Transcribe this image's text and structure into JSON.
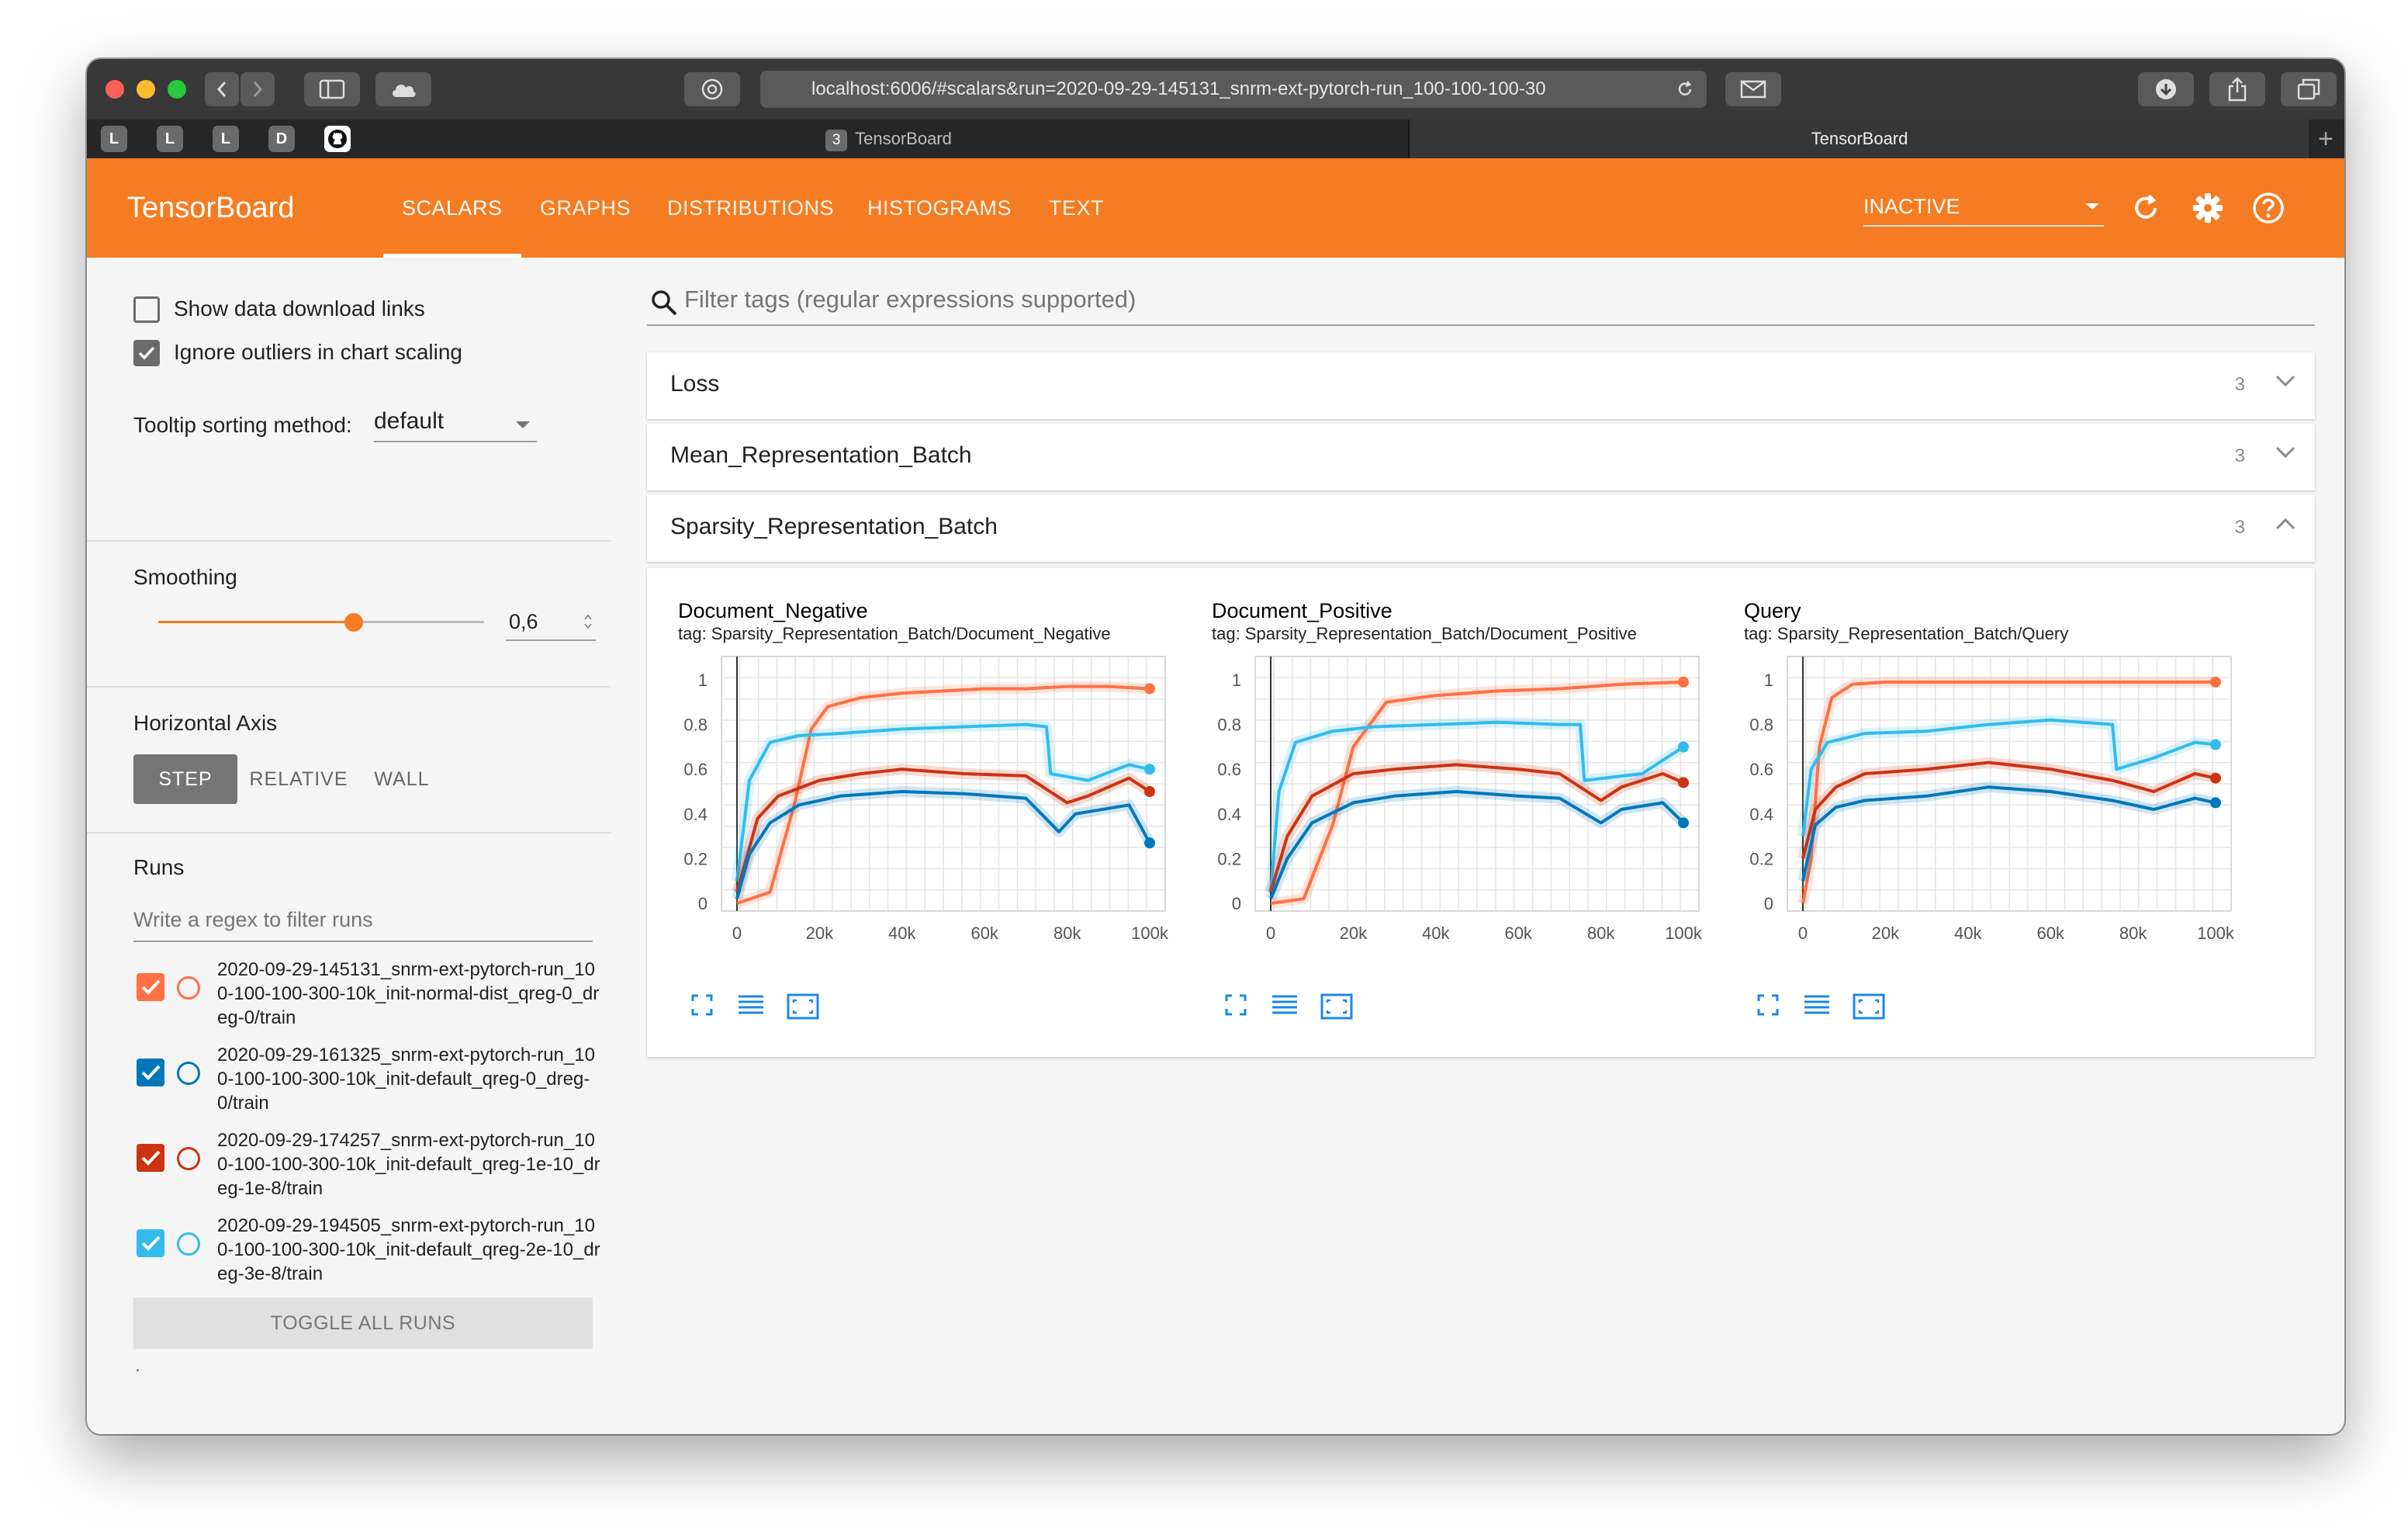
{
  "browser": {
    "url": "localhost:6006/#scalars&run=2020-09-29-145131_snrm-ext-pytorch-run_100-100-100-30",
    "bookmarks": [
      "L",
      "L",
      "L",
      "D"
    ],
    "tabs": [
      {
        "badge": "3",
        "label": "TensorBoard"
      },
      {
        "label": "TensorBoard"
      }
    ]
  },
  "header": {
    "brand": "TensorBoard",
    "nav": [
      "SCALARS",
      "GRAPHS",
      "DISTRIBUTIONS",
      "HISTOGRAMS",
      "TEXT"
    ],
    "active_nav": "SCALARS",
    "run_selector": "INACTIVE",
    "icons": [
      "refresh-icon",
      "settings-gear-icon",
      "help-icon"
    ]
  },
  "sidebar": {
    "show_download": {
      "label": "Show data download links",
      "checked": false
    },
    "ignore_outliers": {
      "label": "Ignore outliers in chart scaling",
      "checked": true
    },
    "tooltip_sort": {
      "label": "Tooltip sorting method:",
      "value": "default"
    },
    "smoothing": {
      "label": "Smoothing",
      "value": "0,6",
      "fraction": 0.6
    },
    "horizontal_axis": {
      "label": "Horizontal Axis",
      "options": [
        "STEP",
        "RELATIVE",
        "WALL"
      ],
      "selected": "STEP"
    },
    "runs": {
      "label": "Runs",
      "filter_placeholder": "Write a regex to filter runs",
      "items": [
        {
          "name": "2020-09-29-145131_snrm-ext-pytorch-run_100-100-100-300-10k_init-normal-dist_qreg-0_dreg-0/train",
          "color": "#ff7043",
          "checked": true
        },
        {
          "name": "2020-09-29-161325_snrm-ext-pytorch-run_100-100-100-300-10k_init-default_qreg-0_dreg-0/train",
          "color": "#0077bb",
          "checked": true
        },
        {
          "name": "2020-09-29-174257_snrm-ext-pytorch-run_100-100-100-300-10k_init-default_qreg-1e-10_dreg-1e-8/train",
          "color": "#cc3311",
          "checked": true
        },
        {
          "name": "2020-09-29-194505_snrm-ext-pytorch-run_100-100-100-300-10k_init-default_qreg-2e-10_dreg-3e-8/train",
          "color": "#33bbee",
          "checked": true
        }
      ],
      "toggle_label": "TOGGLE ALL RUNS",
      "footer": "."
    }
  },
  "main": {
    "filter_placeholder": "Filter tags (regular expressions supported)",
    "categories": [
      {
        "title": "Loss",
        "count": "3",
        "expanded": false
      },
      {
        "title": "Mean_Representation_Batch",
        "count": "3",
        "expanded": false
      },
      {
        "title": "Sparsity_Representation_Batch",
        "count": "3",
        "expanded": true
      }
    ]
  },
  "chart_data": [
    {
      "type": "line",
      "title": "Document_Negative",
      "tag": "tag: Sparsity_Representation_Batch/Document_Negative",
      "x_ticks": [
        "0",
        "20k",
        "40k",
        "60k",
        "80k",
        "100k"
      ],
      "y_ticks": [
        "0",
        "0.2",
        "0.4",
        "0.6",
        "0.8",
        "1"
      ],
      "xlim": [
        0,
        100000
      ],
      "ylim": [
        0,
        1
      ],
      "series": [
        {
          "color": "#ff7043",
          "x": [
            0,
            8000,
            14000,
            18000,
            22000,
            30000,
            40000,
            50000,
            60000,
            70000,
            80000,
            90000,
            100000
          ],
          "y": [
            0.0,
            0.05,
            0.45,
            0.78,
            0.88,
            0.92,
            0.94,
            0.95,
            0.96,
            0.96,
            0.97,
            0.97,
            0.96
          ]
        },
        {
          "color": "#33bbee",
          "x": [
            0,
            3000,
            8000,
            15000,
            25000,
            40000,
            55000,
            70000,
            75000,
            76000,
            85000,
            95000,
            100000
          ],
          "y": [
            0.1,
            0.55,
            0.72,
            0.75,
            0.76,
            0.78,
            0.79,
            0.8,
            0.79,
            0.58,
            0.55,
            0.62,
            0.6
          ]
        },
        {
          "color": "#cc3311",
          "x": [
            0,
            5000,
            10000,
            20000,
            30000,
            40000,
            55000,
            70000,
            80000,
            85000,
            95000,
            100000
          ],
          "y": [
            0.05,
            0.38,
            0.48,
            0.55,
            0.58,
            0.6,
            0.58,
            0.57,
            0.45,
            0.48,
            0.56,
            0.5
          ]
        },
        {
          "color": "#0077bb",
          "x": [
            0,
            3000,
            8000,
            15000,
            25000,
            40000,
            55000,
            70000,
            78000,
            82000,
            95000,
            100000
          ],
          "y": [
            0.02,
            0.22,
            0.36,
            0.44,
            0.48,
            0.5,
            0.49,
            0.47,
            0.32,
            0.4,
            0.44,
            0.27
          ]
        }
      ]
    },
    {
      "type": "line",
      "title": "Document_Positive",
      "tag": "tag: Sparsity_Representation_Batch/Document_Positive",
      "x_ticks": [
        "0",
        "20k",
        "40k",
        "60k",
        "80k",
        "100k"
      ],
      "y_ticks": [
        "0",
        "0.2",
        "0.4",
        "0.6",
        "0.8",
        "1"
      ],
      "xlim": [
        0,
        100000
      ],
      "ylim": [
        0,
        1
      ],
      "series": [
        {
          "color": "#ff7043",
          "x": [
            0,
            8000,
            15000,
            20000,
            28000,
            40000,
            55000,
            70000,
            85000,
            100000
          ],
          "y": [
            0.0,
            0.02,
            0.35,
            0.7,
            0.9,
            0.93,
            0.95,
            0.96,
            0.98,
            0.99
          ]
        },
        {
          "color": "#33bbee",
          "x": [
            0,
            2000,
            6000,
            15000,
            25000,
            40000,
            55000,
            70000,
            75000,
            76000,
            90000,
            100000
          ],
          "y": [
            0.05,
            0.5,
            0.72,
            0.77,
            0.79,
            0.8,
            0.81,
            0.8,
            0.8,
            0.55,
            0.58,
            0.7
          ]
        },
        {
          "color": "#cc3311",
          "x": [
            0,
            4000,
            10000,
            20000,
            30000,
            45000,
            60000,
            70000,
            80000,
            85000,
            95000,
            100000
          ],
          "y": [
            0.05,
            0.3,
            0.48,
            0.58,
            0.6,
            0.62,
            0.6,
            0.58,
            0.46,
            0.52,
            0.58,
            0.54
          ]
        },
        {
          "color": "#0077bb",
          "x": [
            0,
            4000,
            10000,
            20000,
            30000,
            45000,
            60000,
            70000,
            80000,
            85000,
            95000,
            100000
          ],
          "y": [
            0.02,
            0.2,
            0.36,
            0.45,
            0.48,
            0.5,
            0.48,
            0.47,
            0.36,
            0.42,
            0.45,
            0.36
          ]
        }
      ]
    },
    {
      "type": "line",
      "title": "Query",
      "tag": "tag: Sparsity_Representation_Batch/Query",
      "x_ticks": [
        "0",
        "20k",
        "40k",
        "60k",
        "80k",
        "100k"
      ],
      "y_ticks": [
        "0",
        "0.2",
        "0.4",
        "0.6",
        "0.8",
        "1"
      ],
      "xlim": [
        0,
        100000
      ],
      "ylim": [
        0,
        1
      ],
      "series": [
        {
          "color": "#ff7043",
          "x": [
            0,
            2000,
            4000,
            7000,
            12000,
            20000,
            40000,
            60000,
            80000,
            100000
          ],
          "y": [
            0.0,
            0.2,
            0.7,
            0.92,
            0.98,
            0.99,
            0.99,
            0.99,
            0.99,
            0.99
          ]
        },
        {
          "color": "#33bbee",
          "x": [
            0,
            2000,
            6000,
            15000,
            30000,
            45000,
            60000,
            75000,
            76000,
            85000,
            95000,
            100000
          ],
          "y": [
            0.3,
            0.6,
            0.72,
            0.76,
            0.77,
            0.8,
            0.82,
            0.8,
            0.6,
            0.65,
            0.72,
            0.71
          ]
        },
        {
          "color": "#cc3311",
          "x": [
            0,
            3000,
            8000,
            15000,
            30000,
            45000,
            60000,
            75000,
            85000,
            95000,
            100000
          ],
          "y": [
            0.2,
            0.42,
            0.52,
            0.58,
            0.6,
            0.63,
            0.6,
            0.55,
            0.5,
            0.58,
            0.56
          ]
        },
        {
          "color": "#0077bb",
          "x": [
            0,
            3000,
            8000,
            15000,
            30000,
            45000,
            60000,
            75000,
            85000,
            95000,
            100000
          ],
          "y": [
            0.1,
            0.35,
            0.43,
            0.46,
            0.48,
            0.52,
            0.5,
            0.46,
            0.42,
            0.47,
            0.45
          ]
        }
      ]
    }
  ]
}
